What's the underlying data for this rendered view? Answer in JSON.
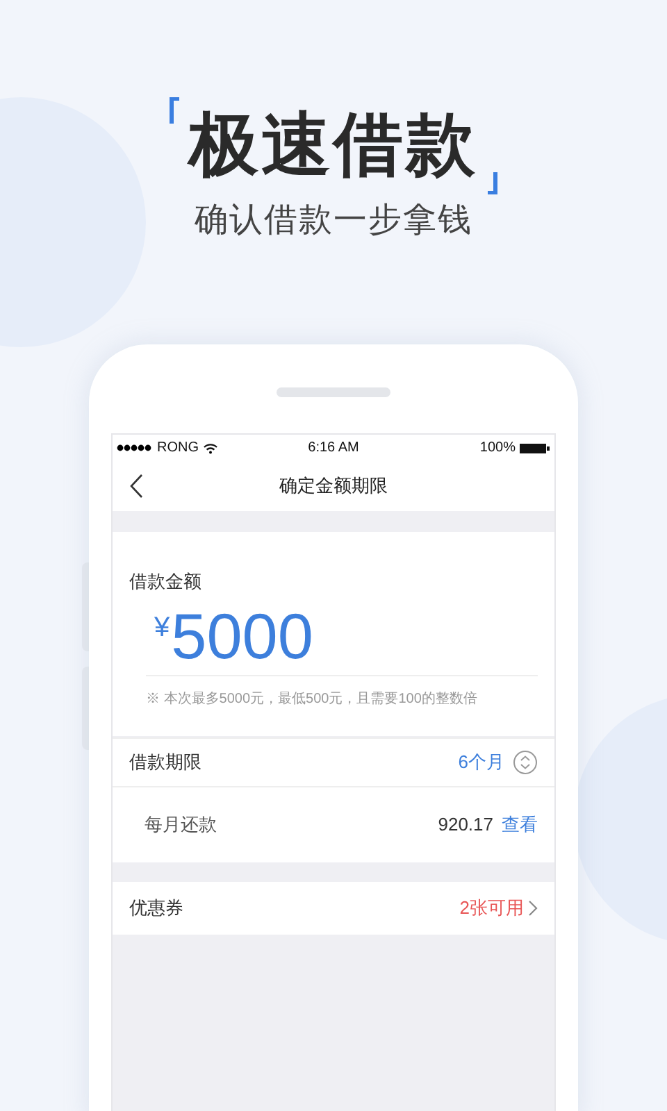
{
  "headline": "极速借款",
  "subtitle": "确认借款一步拿钱",
  "status_bar": {
    "carrier": "RONG",
    "time": "6:16 AM",
    "battery": "100%"
  },
  "nav": {
    "title": "确定金额期限"
  },
  "amount": {
    "label": "借款金额",
    "currency": "¥",
    "value": "5000",
    "note": "※ 本次最多5000元，最低500元，且需要100的整数倍"
  },
  "rows": [
    {
      "kind": "select",
      "label": "借款期限",
      "value": "6个月"
    },
    {
      "kind": "detail",
      "label": "每月还款",
      "value": "920.17",
      "link": "查看"
    },
    {
      "kind": "nav",
      "label": "优惠券",
      "value": "2张可用"
    }
  ]
}
